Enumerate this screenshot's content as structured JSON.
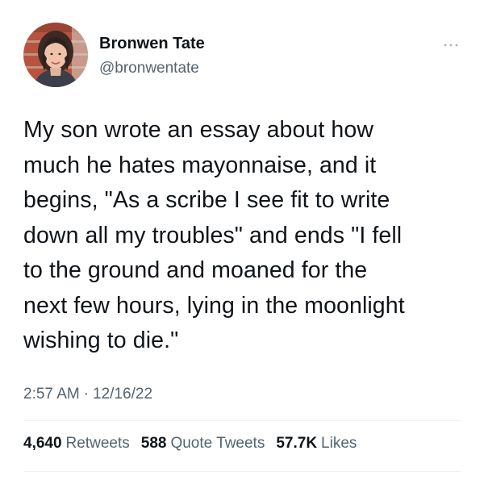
{
  "author": {
    "display_name": "Bronwen Tate",
    "handle": "@bronwentate",
    "avatar_icon": "profile-photo"
  },
  "more_icon": "more-horizontal-icon",
  "tweet": {
    "lines": [
      "My son wrote an essay about how",
      "much he hates mayonnaise, and it",
      "begins, \"As a scribe I see fit to write",
      "down all my troubles\" and ends \"I fell",
      "to the ground and moaned for the",
      "next few hours, lying in the moonlight",
      "wishing to die.\""
    ]
  },
  "meta": {
    "time": "2:57 AM",
    "separator": "·",
    "date": "12/16/22"
  },
  "stats": {
    "retweets": {
      "count": "4,640",
      "label": "Retweets"
    },
    "quotes": {
      "count": "588",
      "label": "Quote Tweets"
    },
    "likes": {
      "count": "57.7K",
      "label": "Likes"
    }
  },
  "colors": {
    "text_primary": "#0f1419",
    "text_secondary": "#536471",
    "divider": "#eff3f4"
  }
}
